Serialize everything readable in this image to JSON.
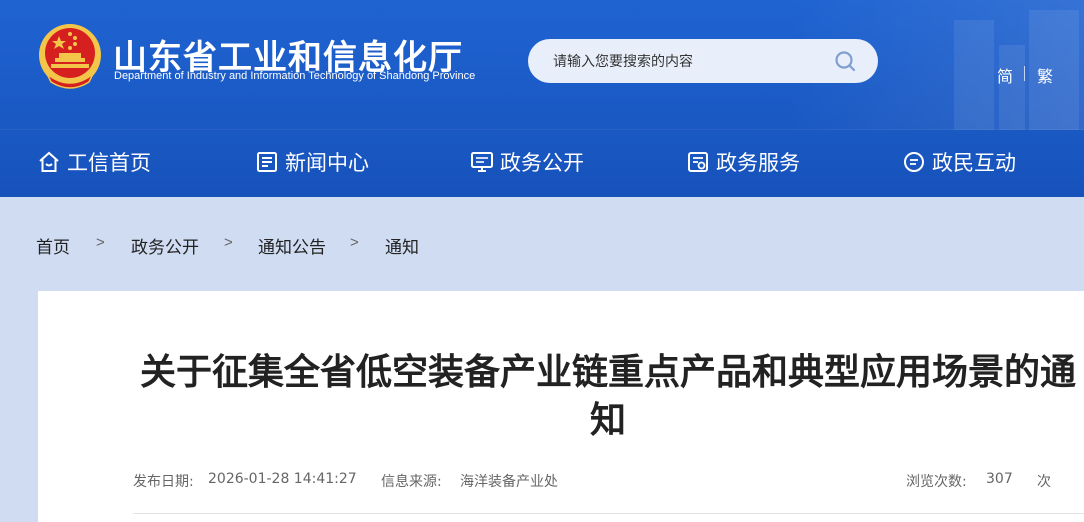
{
  "header": {
    "title": "山东省工业和信息化厅",
    "subtitle": "Department of Industry and Information Technology of Shandong Province",
    "search_placeholder": "请输入您要搜索的内容",
    "lang_simplified": "简",
    "lang_traditional": "繁"
  },
  "nav": {
    "items": [
      {
        "label": "工信首页",
        "icon": "home-icon"
      },
      {
        "label": "新闻中心",
        "icon": "newspaper-icon"
      },
      {
        "label": "政务公开",
        "icon": "monitor-icon"
      },
      {
        "label": "政务服务",
        "icon": "service-icon"
      },
      {
        "label": "政民互动",
        "icon": "chat-icon"
      }
    ]
  },
  "breadcrumb": {
    "items": [
      "首页",
      "政务公开",
      "通知公告",
      "通知"
    ],
    "separator": ">"
  },
  "article": {
    "title": "关于征集全省低空装备产业链重点产品和典型应用场景的通知",
    "publish_label": "发布日期:",
    "publish_date": "2026-01-28 14:41:27",
    "source_label": "信息来源:",
    "source": "海洋装备产业处",
    "views_label": "浏览次数:",
    "views": "307",
    "views_unit": "次"
  },
  "colors": {
    "header_blue": "#1f63d1",
    "page_bg": "#cfdcf1",
    "emblem_red": "#d6201f",
    "emblem_gold": "#f3c64a"
  }
}
